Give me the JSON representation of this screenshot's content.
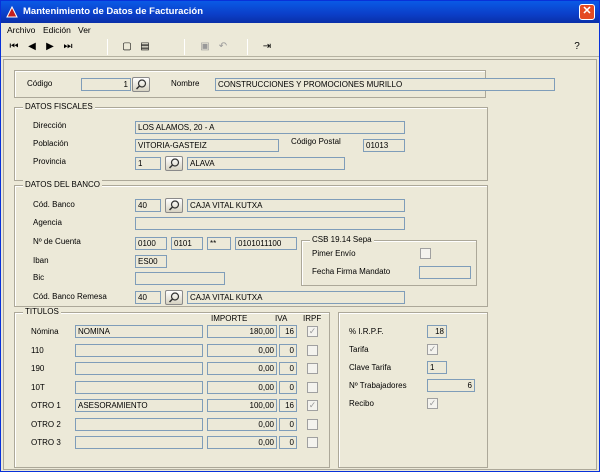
{
  "window": {
    "title": "Mantenimiento de Datos de Facturación"
  },
  "menu": {
    "archivo": "Archivo",
    "edicion": "Edición",
    "ver": "Ver"
  },
  "header": {
    "codigo_label": "Código",
    "codigo_value": "1",
    "nombre_label": "Nombre",
    "nombre_value": "CONSTRUCCIONES Y PROMOCIONES MURILLO"
  },
  "fiscal": {
    "title": "DATOS FISCALES",
    "direccion_label": "Dirección",
    "direccion_value": "LOS ALAMOS, 20 - A",
    "poblacion_label": "Población",
    "poblacion_value": "VITORIA-GASTEIZ",
    "cp_label": "Código Postal",
    "cp_value": "01013",
    "provincia_label": "Provincia",
    "provincia_code": "1",
    "provincia_value": "ALAVA"
  },
  "banco": {
    "title": "DATOS DEL BANCO",
    "cod_label": "Cód. Banco",
    "cod_value": "40",
    "cod_name": "CAJA VITAL KUTXA",
    "agencia_label": "Agencia",
    "agencia_value": "",
    "cuenta_label": "Nº de Cuenta",
    "cuenta_1": "0100",
    "cuenta_2": "0101",
    "cuenta_3": "**",
    "cuenta_4": "0101011100",
    "iban_label": "Iban",
    "iban_value": "ES00",
    "bic_label": "Bic",
    "bic_value": "",
    "remesa_label": "Cód. Banco Remesa",
    "remesa_value": "40",
    "remesa_name": "CAJA VITAL KUTXA",
    "csb_title": "CSB 19.14 Sepa",
    "primer_envio_label": "Pimer Envío",
    "fecha_label": "Fecha Firma Mandato",
    "fecha_value": ""
  },
  "titulos": {
    "title": "TITULOS",
    "col_importe": "IMPORTE",
    "col_iva": "IVA",
    "col_irpf": "IRPF",
    "rows": [
      {
        "label": "Nómina",
        "desc": "NOMINA",
        "importe": "180,00",
        "iva": "16",
        "irpf": true
      },
      {
        "label": "110",
        "desc": "",
        "importe": "0,00",
        "iva": "0",
        "irpf": false
      },
      {
        "label": "190",
        "desc": "",
        "importe": "0,00",
        "iva": "0",
        "irpf": false
      },
      {
        "label": "10T",
        "desc": "",
        "importe": "0,00",
        "iva": "0",
        "irpf": false
      },
      {
        "label": "OTRO 1",
        "desc": "ASESORAMIENTO",
        "importe": "100,00",
        "iva": "16",
        "irpf": true
      },
      {
        "label": "OTRO 2",
        "desc": "",
        "importe": "0,00",
        "iva": "0",
        "irpf": false
      },
      {
        "label": "OTRO 3",
        "desc": "",
        "importe": "0,00",
        "iva": "0",
        "irpf": false
      }
    ]
  },
  "extra": {
    "irpf_label": "% I.R.P.F.",
    "irpf_value": "18",
    "tarifa_label": "Tarifa",
    "tarifa_checked": true,
    "clave_label": "Clave Tarifa",
    "clave_value": "1",
    "trab_label": "Nº Trabajadores",
    "trab_value": "6",
    "recibo_label": "Recibo",
    "recibo_checked": true
  },
  "colors": {
    "titlebar": "#0b3fc8",
    "window_bg": "#ece9d8",
    "field_border": "#7f9db9"
  }
}
